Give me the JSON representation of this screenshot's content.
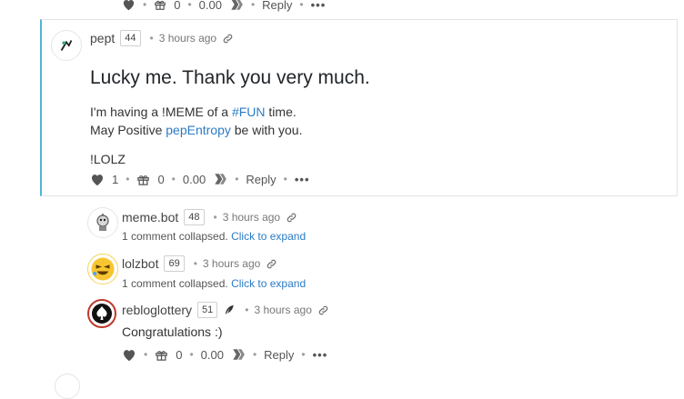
{
  "top_action_row": {
    "tip_count": "0",
    "amount": "0.00",
    "reply_label": "Reply",
    "more_label": "•••"
  },
  "main_comment": {
    "author": "pept",
    "reputation": "44",
    "time": "3 hours ago",
    "title": "Lucky me. Thank you very much.",
    "line1_before": "I'm having a !MEME of a ",
    "line1_tag": "#FUN",
    "line1_after": " time.",
    "line2_before": "May Positive ",
    "line2_link": "pepEntropy",
    "line2_after": " be with you.",
    "line3": "!LOLZ",
    "like_count": "1",
    "tip_count": "0",
    "amount": "0.00",
    "reply_label": "Reply",
    "more_label": "•••"
  },
  "replies": [
    {
      "author": "meme.bot",
      "reputation": "48",
      "time": "3 hours ago",
      "collapsed_text": "1 comment collapsed.",
      "expand_label": "Click to expand"
    },
    {
      "author": "lolzbot",
      "reputation": "69",
      "time": "3 hours ago",
      "collapsed_text": "1 comment collapsed.",
      "expand_label": "Click to expand"
    },
    {
      "author": "rebloglottery",
      "reputation": "51",
      "time": "3 hours ago",
      "body": "Congratulations :)",
      "tip_count": "0",
      "amount": "0.00",
      "reply_label": "Reply",
      "more_label": "•••"
    }
  ],
  "separator": "•",
  "colors": {
    "link": "#2b7bc5",
    "highlight_border": "#54b2d8",
    "icon_gray": "#555555"
  }
}
